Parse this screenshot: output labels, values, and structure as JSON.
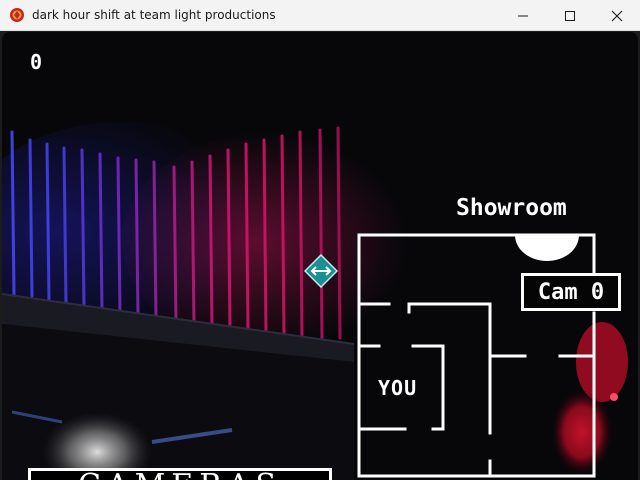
{
  "window": {
    "title": "dark hour shift at team light productions"
  },
  "hud": {
    "counter": "0"
  },
  "camera": {
    "room_name": "Showroom",
    "cam_label": "Cam 0",
    "you_label": "YOU"
  },
  "panel": {
    "cameras_label": "CAMERAS"
  },
  "icons": {
    "app": "game-app-icon",
    "swap": "swap-arrows-icon"
  },
  "colors": {
    "accent_teal": "#1fa3a3",
    "map_lines": "#ffffff",
    "neon_pink": "#e0156f",
    "neon_blue": "#3a3aff"
  }
}
